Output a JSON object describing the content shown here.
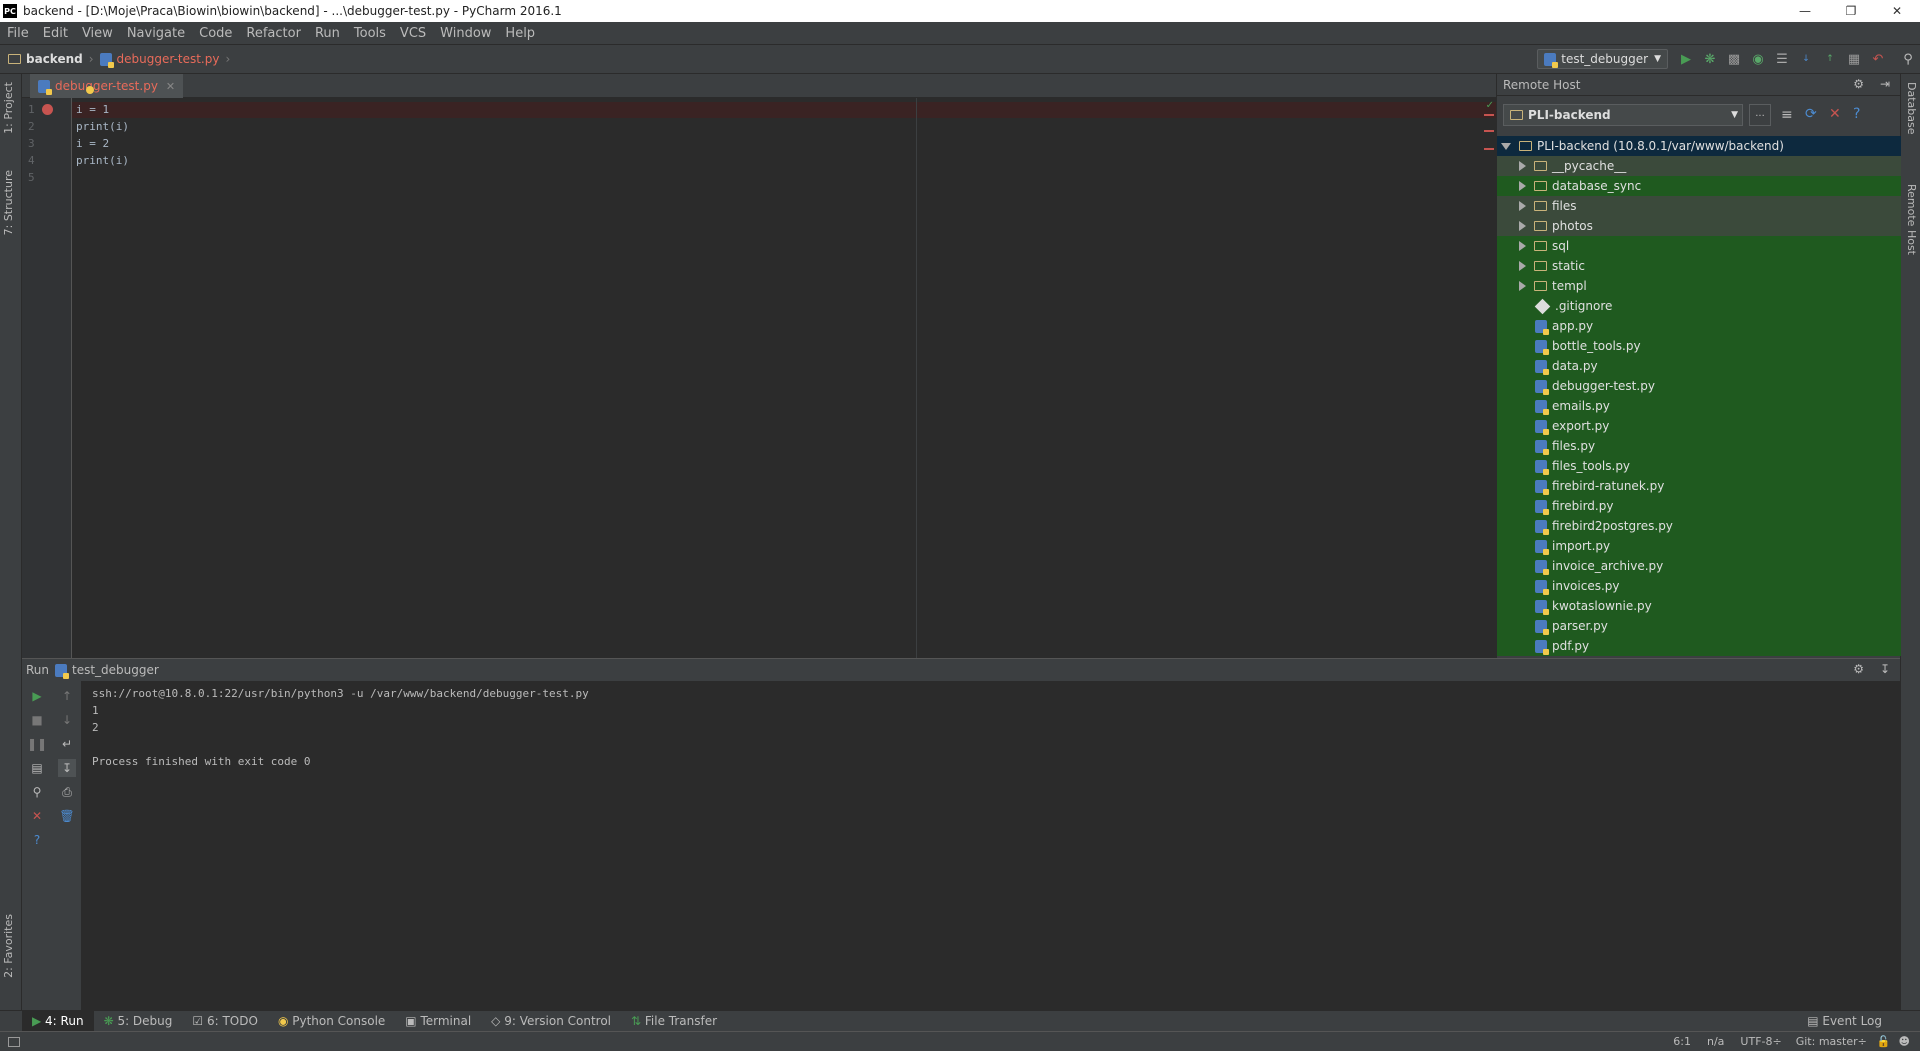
{
  "window": {
    "title": "backend - [D:\\Moje\\Praca\\Biowin\\biowin\\backend] - ...\\debugger-test.py - PyCharm 2016.1",
    "app_icon_text": "PC"
  },
  "menu": [
    "File",
    "Edit",
    "View",
    "Navigate",
    "Code",
    "Refactor",
    "Run",
    "Tools",
    "VCS",
    "Window",
    "Help"
  ],
  "breadcrumb": {
    "project": "backend",
    "file": "debugger-test.py"
  },
  "toolbar": {
    "run_config": "test_debugger"
  },
  "left_strip": {
    "project": "1: Project",
    "structure": "7: Structure",
    "favorites": "2: Favorites"
  },
  "right_strip": {
    "database": "Database",
    "remote_host": "Remote Host"
  },
  "editor": {
    "tab_label": "debugger-test.py",
    "lines": [
      {
        "n": "1",
        "code": "i = 1"
      },
      {
        "n": "2",
        "code": "print(i)"
      },
      {
        "n": "3",
        "code": "i = 2"
      },
      {
        "n": "4",
        "code": "print(i)"
      },
      {
        "n": "5",
        "code": ""
      }
    ]
  },
  "remote_host": {
    "title": "Remote Host",
    "server": "PLI-backend",
    "root": "PLI-backend (10.8.0.1/var/www/backend)",
    "folders": [
      "__pycache__",
      "database_sync",
      "files",
      "photos",
      "sql",
      "static",
      "templ"
    ],
    "files": [
      ".gitignore",
      "app.py",
      "bottle_tools.py",
      "data.py",
      "debugger-test.py",
      "emails.py",
      "export.py",
      "files.py",
      "files_tools.py",
      "firebird-ratunek.py",
      "firebird.py",
      "firebird2postgres.py",
      "import.py",
      "invoice_archive.py",
      "invoices.py",
      "kwotaslownie.py",
      "parser.py",
      "pdf.py"
    ]
  },
  "run_panel": {
    "label": "Run",
    "config": "test_debugger",
    "console": [
      "ssh://root@10.8.0.1:22/usr/bin/python3 -u /var/www/backend/debugger-test.py",
      "1",
      "2",
      "",
      "Process finished with exit code 0"
    ]
  },
  "bottom_tabs": [
    "4: Run",
    "5: Debug",
    "6: TODO",
    "Python Console",
    "Terminal",
    "9: Version Control",
    "File Transfer"
  ],
  "event_log": "Event Log",
  "status": {
    "position": "6:1",
    "na": "n/a",
    "encoding": "UTF-8÷",
    "git": "Git: master÷"
  },
  "colors": {
    "green_highlight": "#1f5a1f",
    "selected": "#0d293e",
    "error_red": "#c75450",
    "bg": "#2b2b2b"
  }
}
